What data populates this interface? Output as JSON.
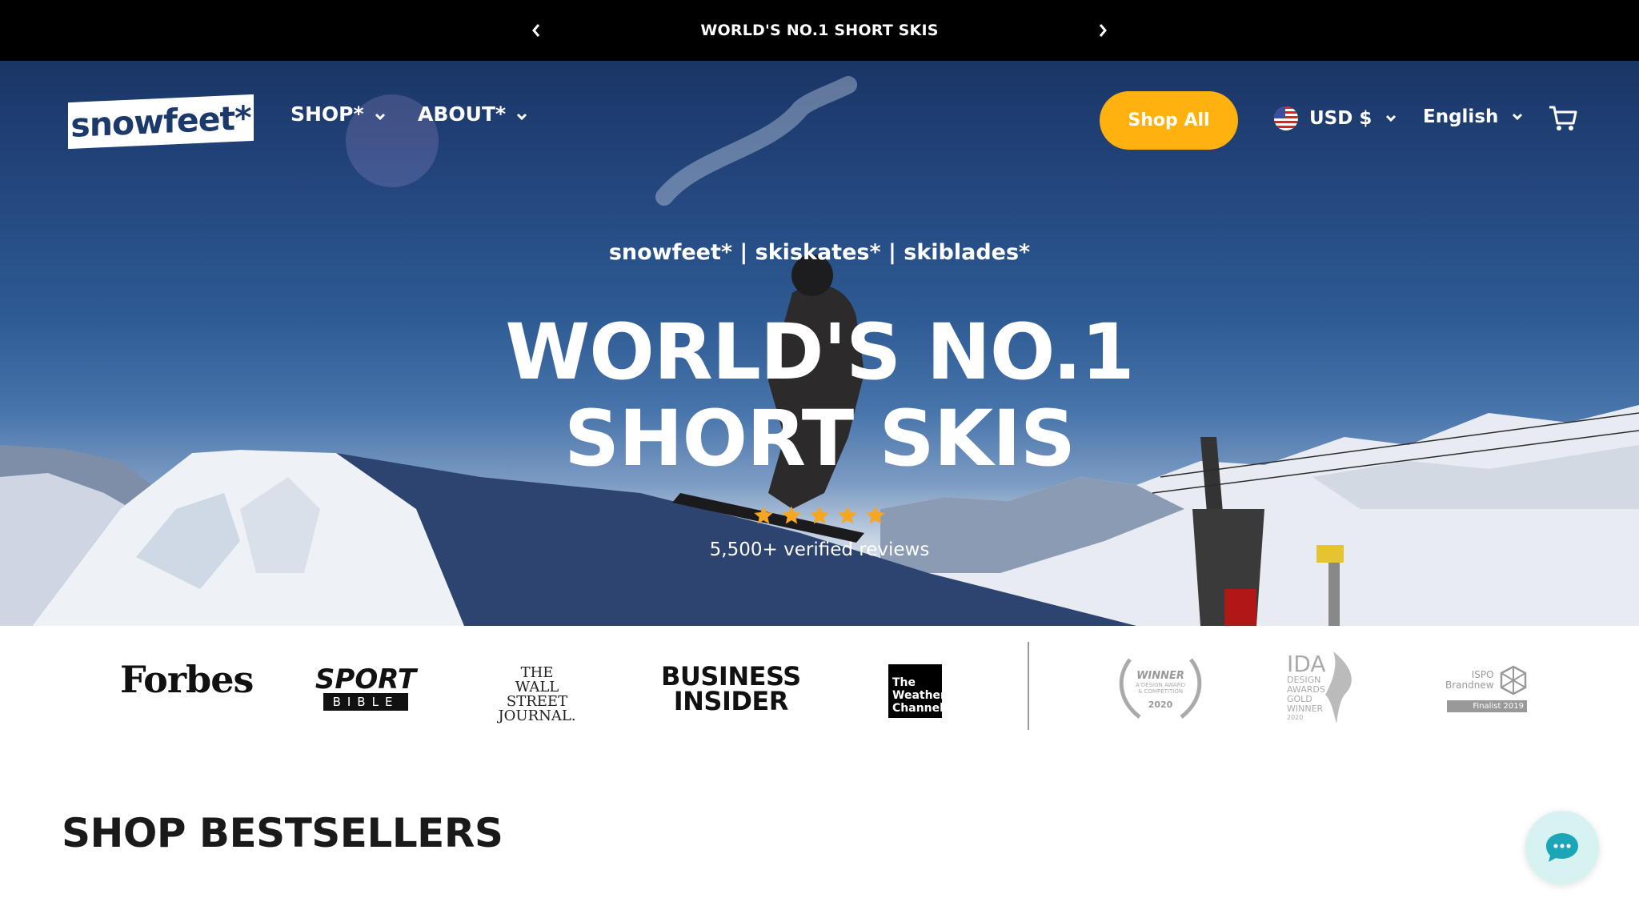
{
  "announcement": {
    "text": "WORLD'S NO.1 SHORT SKIS",
    "prev_icon": "chevron-left-icon",
    "next_icon": "chevron-right-icon"
  },
  "header": {
    "logo": "snowfeet*",
    "nav": [
      {
        "label": "SHOP*",
        "icon": "chevron-down-icon"
      },
      {
        "label": "ABOUT*",
        "icon": "chevron-down-icon"
      }
    ],
    "cta": "Shop All",
    "currency": {
      "label": "USD $",
      "flag": "us-flag-icon"
    },
    "language": "English",
    "cart_icon": "cart-icon"
  },
  "hero": {
    "subtitle": "snowfeet* | skiskates* | skiblades*",
    "title_line1": "WORLD'S NO.1",
    "title_line2": "SHORT SKIS",
    "rating": 5,
    "reviews": "5,500+ verified reviews"
  },
  "press": {
    "forbes": "Forbes",
    "sport_bible_top": "SPORT",
    "sport_bible_bottom": "BIBLE",
    "wsj": [
      "THE",
      "WALL STREET",
      "JOURNAL."
    ],
    "business_insider": [
      "BUSINESS",
      "INSIDER"
    ],
    "weather_channel": [
      "The",
      "Weather",
      "Channel"
    ],
    "award1": [
      "WINNER",
      "A'DESIGN AWARD",
      "& COMPETITION",
      "2020"
    ],
    "award2": [
      "IDA",
      "DESIGN",
      "AWARDS",
      "GOLD",
      "WINNER",
      "2020"
    ],
    "award3": [
      "ISPO",
      "Brandnew",
      "Finalist 2019"
    ]
  },
  "section": {
    "title": "SHOP BESTSELLERS"
  },
  "chat": {
    "icon": "chat-icon"
  },
  "colors": {
    "accent": "#ffb10d",
    "logo_blue": "#1b3a6b",
    "star": "#f5a623",
    "chat_bg": "#d6f3f2",
    "chat_icon": "#1aa6b7"
  }
}
